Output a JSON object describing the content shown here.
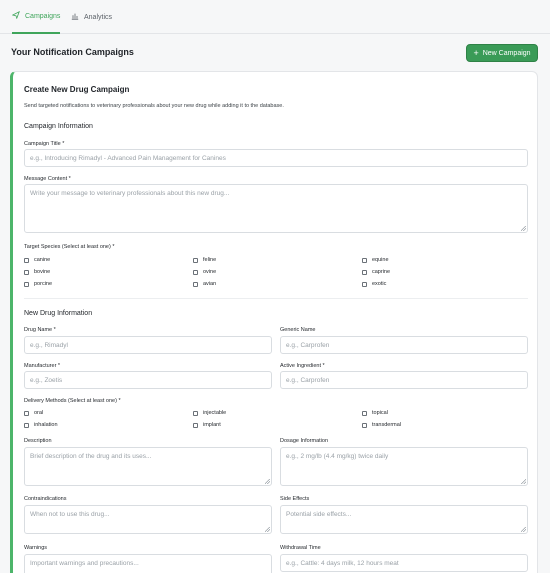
{
  "tabs": [
    {
      "label": "Campaigns",
      "icon": "send-icon",
      "active": true
    },
    {
      "label": "Analytics",
      "icon": "bar-chart-icon",
      "active": false
    }
  ],
  "header": {
    "title": "Your Notification Campaigns",
    "new_button": "New Campaign"
  },
  "form": {
    "title": "Create New Drug Campaign",
    "subtitle": "Send targeted notifications to veterinary professionals about your new drug while adding it to the database.",
    "campaign_section": "Campaign Information",
    "campaign_title_label": "Campaign Title *",
    "campaign_title_placeholder": "e.g., Introducing Rimadyl - Advanced Pain Management for Canines",
    "message_label": "Message Content *",
    "message_placeholder": "Write your message to veterinary professionals about this new drug...",
    "species_label": "Target Species (Select at least one) *",
    "species": [
      "canine",
      "feline",
      "equine",
      "bovine",
      "ovine",
      "caprine",
      "porcine",
      "avian",
      "exotic"
    ],
    "drug_section": "New Drug Information",
    "drug_name_label": "Drug Name *",
    "drug_name_placeholder": "e.g., Rimadyl",
    "generic_label": "Generic Name",
    "generic_placeholder": "e.g., Carprofen",
    "manufacturer_label": "Manufacturer *",
    "manufacturer_placeholder": "e.g., Zoetis",
    "ingredient_label": "Active Ingredient *",
    "ingredient_placeholder": "e.g., Carprofen",
    "delivery_label": "Delivery Methods (Select at least one) *",
    "delivery": [
      "oral",
      "injectable",
      "topical",
      "inhalation",
      "implant",
      "transdermal"
    ],
    "description_label": "Description",
    "description_placeholder": "Brief description of the drug and its uses...",
    "dosage_label": "Dosage Information",
    "dosage_placeholder": "e.g., 2 mg/lb (4.4 mg/kg) twice daily",
    "contra_label": "Contraindications",
    "contra_placeholder": "When not to use this drug...",
    "side_label": "Side Effects",
    "side_placeholder": "Potential side effects...",
    "warnings_label": "Warnings",
    "warnings_placeholder": "Important warnings and precautions...",
    "withdrawal_label": "Withdrawal Time",
    "withdrawal_placeholder": "e.g., Cattle: 4 days milk, 12 hours meat"
  },
  "colors": {
    "accent": "#3a9b57",
    "card_border_accent": "#4db56a"
  }
}
